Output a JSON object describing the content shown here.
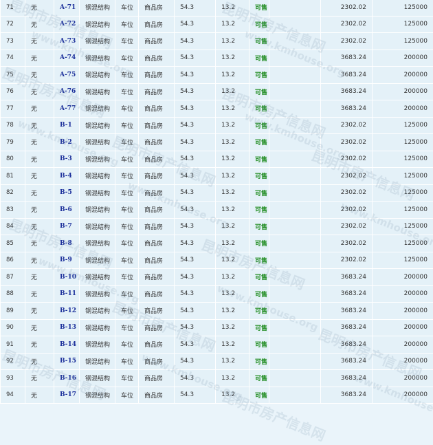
{
  "rows": [
    {
      "no": "71",
      "floor": "无",
      "room": "A-71",
      "structure": "钢混结构",
      "usage": "车位",
      "type": "商品房",
      "area1": "54.3",
      "area2": "13.2",
      "status": "可售",
      "unit_price": "2302.02",
      "total_price": "125000"
    },
    {
      "no": "72",
      "floor": "无",
      "room": "A-72",
      "structure": "钢混结构",
      "usage": "车位",
      "type": "商品房",
      "area1": "54.3",
      "area2": "13.2",
      "status": "可售",
      "unit_price": "2302.02",
      "total_price": "125000"
    },
    {
      "no": "73",
      "floor": "无",
      "room": "A-73",
      "structure": "钢混结构",
      "usage": "车位",
      "type": "商品房",
      "area1": "54.3",
      "area2": "13.2",
      "status": "可售",
      "unit_price": "2302.02",
      "total_price": "125000"
    },
    {
      "no": "74",
      "floor": "无",
      "room": "A-74",
      "structure": "钢混结构",
      "usage": "车位",
      "type": "商品房",
      "area1": "54.3",
      "area2": "13.2",
      "status": "可售",
      "unit_price": "3683.24",
      "total_price": "200000"
    },
    {
      "no": "75",
      "floor": "无",
      "room": "A-75",
      "structure": "钢混结构",
      "usage": "车位",
      "type": "商品房",
      "area1": "54.3",
      "area2": "13.2",
      "status": "可售",
      "unit_price": "3683.24",
      "total_price": "200000"
    },
    {
      "no": "76",
      "floor": "无",
      "room": "A-76",
      "structure": "钢混结构",
      "usage": "车位",
      "type": "商品房",
      "area1": "54.3",
      "area2": "13.2",
      "status": "可售",
      "unit_price": "3683.24",
      "total_price": "200000"
    },
    {
      "no": "77",
      "floor": "无",
      "room": "A-77",
      "structure": "钢混结构",
      "usage": "车位",
      "type": "商品房",
      "area1": "54.3",
      "area2": "13.2",
      "status": "可售",
      "unit_price": "3683.24",
      "total_price": "200000"
    },
    {
      "no": "78",
      "floor": "无",
      "room": "B-1",
      "structure": "钢混结构",
      "usage": "车位",
      "type": "商品房",
      "area1": "54.3",
      "area2": "13.2",
      "status": "可售",
      "unit_price": "2302.02",
      "total_price": "125000"
    },
    {
      "no": "79",
      "floor": "无",
      "room": "B-2",
      "structure": "钢混结构",
      "usage": "车位",
      "type": "商品房",
      "area1": "54.3",
      "area2": "13.2",
      "status": "可售",
      "unit_price": "2302.02",
      "total_price": "125000"
    },
    {
      "no": "80",
      "floor": "无",
      "room": "B-3",
      "structure": "钢混结构",
      "usage": "车位",
      "type": "商品房",
      "area1": "54.3",
      "area2": "13.2",
      "status": "可售",
      "unit_price": "2302.02",
      "total_price": "125000"
    },
    {
      "no": "81",
      "floor": "无",
      "room": "B-4",
      "structure": "钢混结构",
      "usage": "车位",
      "type": "商品房",
      "area1": "54.3",
      "area2": "13.2",
      "status": "可售",
      "unit_price": "2302.02",
      "total_price": "125000"
    },
    {
      "no": "82",
      "floor": "无",
      "room": "B-5",
      "structure": "钢混结构",
      "usage": "车位",
      "type": "商品房",
      "area1": "54.3",
      "area2": "13.2",
      "status": "可售",
      "unit_price": "2302.02",
      "total_price": "125000"
    },
    {
      "no": "83",
      "floor": "无",
      "room": "B-6",
      "structure": "钢混结构",
      "usage": "车位",
      "type": "商品房",
      "area1": "54.3",
      "area2": "13.2",
      "status": "可售",
      "unit_price": "2302.02",
      "total_price": "125000"
    },
    {
      "no": "84",
      "floor": "无",
      "room": "B-7",
      "structure": "钢混结构",
      "usage": "车位",
      "type": "商品房",
      "area1": "54.3",
      "area2": "13.2",
      "status": "可售",
      "unit_price": "2302.02",
      "total_price": "125000"
    },
    {
      "no": "85",
      "floor": "无",
      "room": "B-8",
      "structure": "钢混结构",
      "usage": "车位",
      "type": "商品房",
      "area1": "54.3",
      "area2": "13.2",
      "status": "可售",
      "unit_price": "2302.02",
      "total_price": "125000"
    },
    {
      "no": "86",
      "floor": "无",
      "room": "B-9",
      "structure": "钢混结构",
      "usage": "车位",
      "type": "商品房",
      "area1": "54.3",
      "area2": "13.2",
      "status": "可售",
      "unit_price": "2302.02",
      "total_price": "125000"
    },
    {
      "no": "87",
      "floor": "无",
      "room": "B-10",
      "structure": "钢混结构",
      "usage": "车位",
      "type": "商品房",
      "area1": "54.3",
      "area2": "13.2",
      "status": "可售",
      "unit_price": "3683.24",
      "total_price": "200000"
    },
    {
      "no": "88",
      "floor": "无",
      "room": "B-11",
      "structure": "钢混结构",
      "usage": "车位",
      "type": "商品房",
      "area1": "54.3",
      "area2": "13.2",
      "status": "可售",
      "unit_price": "3683.24",
      "total_price": "200000"
    },
    {
      "no": "89",
      "floor": "无",
      "room": "B-12",
      "structure": "钢混结构",
      "usage": "车位",
      "type": "商品房",
      "area1": "54.3",
      "area2": "13.2",
      "status": "可售",
      "unit_price": "3683.24",
      "total_price": "200000"
    },
    {
      "no": "90",
      "floor": "无",
      "room": "B-13",
      "structure": "钢混结构",
      "usage": "车位",
      "type": "商品房",
      "area1": "54.3",
      "area2": "13.2",
      "status": "可售",
      "unit_price": "3683.24",
      "total_price": "200000"
    },
    {
      "no": "91",
      "floor": "无",
      "room": "B-14",
      "structure": "钢混结构",
      "usage": "车位",
      "type": "商品房",
      "area1": "54.3",
      "area2": "13.2",
      "status": "可售",
      "unit_price": "3683.24",
      "total_price": "200000"
    },
    {
      "no": "92",
      "floor": "无",
      "room": "B-15",
      "structure": "钢混结构",
      "usage": "车位",
      "type": "商品房",
      "area1": "54.3",
      "area2": "13.2",
      "status": "可售",
      "unit_price": "3683.24",
      "total_price": "200000"
    },
    {
      "no": "93",
      "floor": "无",
      "room": "B-16",
      "structure": "钢混结构",
      "usage": "车位",
      "type": "商品房",
      "area1": "54.3",
      "area2": "13.2",
      "status": "可售",
      "unit_price": "3683.24",
      "total_price": "200000"
    },
    {
      "no": "94",
      "floor": "无",
      "room": "B-17",
      "structure": "钢混结构",
      "usage": "车位",
      "type": "商品房",
      "area1": "54.3",
      "area2": "13.2",
      "status": "可售",
      "unit_price": "3683.24",
      "total_price": "200000"
    }
  ],
  "watermark": {
    "cn": "昆明市房产信息网",
    "en": "www.kmhouse.org",
    "color": "#7896aa"
  },
  "colors": {
    "cell_bg": "#e4f1f8",
    "room_text": "#1a2e9a",
    "status_text": "#1c8a1c",
    "grid_line": "#ffffff"
  }
}
